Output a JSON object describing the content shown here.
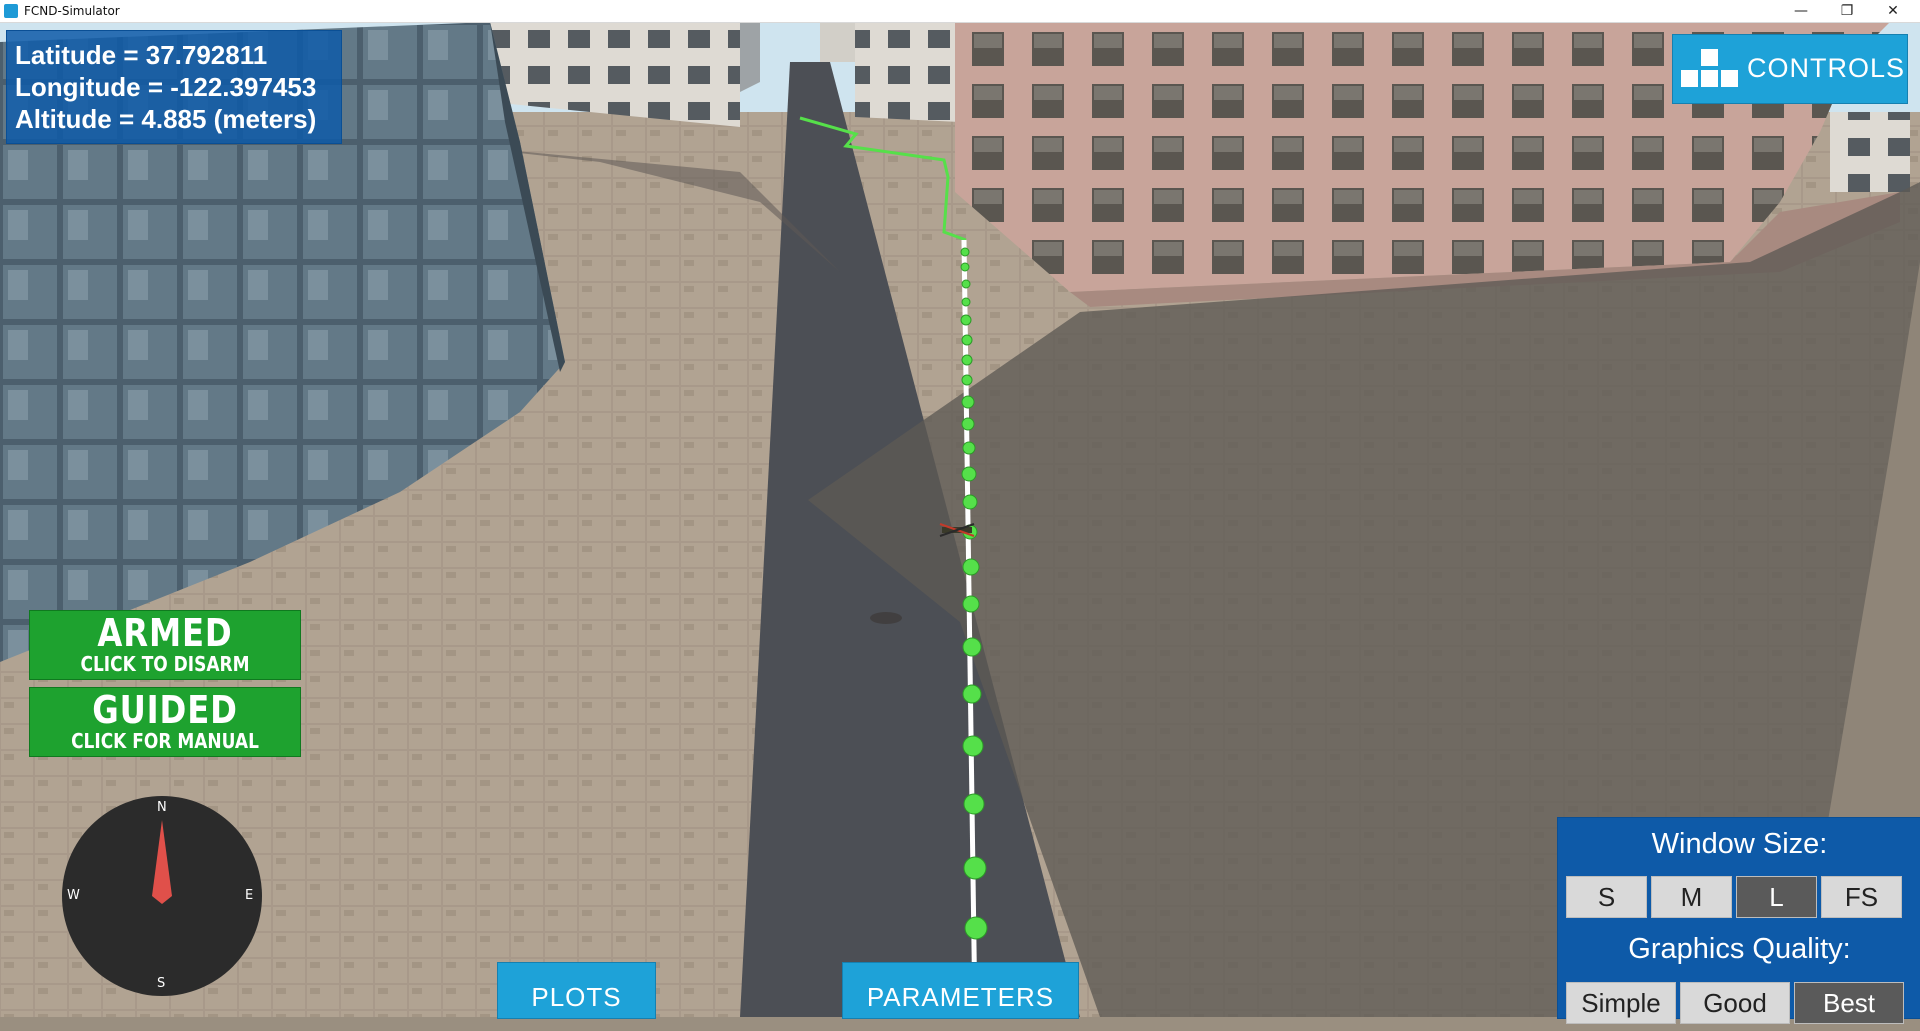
{
  "window": {
    "title": "FCND-Simulator",
    "minimize_glyph": "—",
    "maximize_glyph": "❐",
    "close_glyph": "✕"
  },
  "readout": {
    "latitude": "Latitude = 37.792811",
    "longitude": "Longitude = -122.397453",
    "altitude": "Altitude = 4.885 (meters)"
  },
  "controls": {
    "label": "CONTROLS",
    "icon": "keyboard-keys-icon"
  },
  "armed": {
    "title": "ARMED",
    "subtitle": "CLICK TO DISARM"
  },
  "guided": {
    "title": "GUIDED",
    "subtitle": "CLICK FOR MANUAL"
  },
  "compass": {
    "north": "N",
    "south": "S",
    "east": "E",
    "west": "W",
    "needle_color": "#e0504a"
  },
  "tabs": {
    "plots": "PLOTS",
    "parameters": "PARAMETERS"
  },
  "window_size": {
    "heading": "Window Size:",
    "options": [
      "S",
      "M",
      "L",
      "FS"
    ],
    "selected": "L"
  },
  "graphics_quality": {
    "heading": "Graphics Quality:",
    "options": [
      "Simple",
      "Good",
      "Best"
    ],
    "selected": "Best"
  },
  "colors": {
    "accent_blue": "#1ea2d8",
    "panel_blue": "#0e5aa8",
    "status_green": "#1ea22f",
    "path_green": "#55e04a"
  }
}
